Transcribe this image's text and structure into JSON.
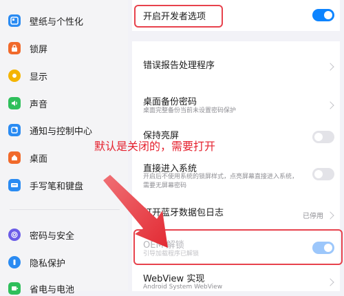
{
  "sidebar": {
    "items": [
      {
        "label": "壁纸与个性化",
        "icon": "palette-icon",
        "color": "#2a8bf2"
      },
      {
        "label": "锁屏",
        "icon": "lock-icon",
        "color": "#f16a2b"
      },
      {
        "label": "显示",
        "icon": "sun-icon",
        "color": "#f4b400"
      },
      {
        "label": "声音",
        "icon": "speaker-icon",
        "color": "#2fbf5b"
      },
      {
        "label": "通知与控制中心",
        "icon": "notification-icon",
        "color": "#2a8bf2"
      },
      {
        "label": "桌面",
        "icon": "home-icon",
        "color": "#f16a2b"
      },
      {
        "label": "手写笔和键盘",
        "icon": "keyboard-icon",
        "color": "#2a8bf2"
      },
      {
        "label": "密码与安全",
        "icon": "fingerprint-icon",
        "color": "#6b5ce7"
      },
      {
        "label": "隐私保护",
        "icon": "privacy-icon",
        "color": "#2a8bf2"
      },
      {
        "label": "省电与电池",
        "icon": "battery-icon",
        "color": "#2fbf5b"
      }
    ]
  },
  "main": {
    "developer_options": {
      "title": "开启开发者选项",
      "enabled": true
    },
    "bug_report": {
      "title": "错误报告处理程序"
    },
    "desktop_backup": {
      "title": "桌面备份密码",
      "subtitle": "桌面完整备份当前未设置密码保护"
    },
    "stay_awake": {
      "title": "保持亮屏",
      "enabled": false
    },
    "direct_boot": {
      "title": "直接进入系统",
      "subtitle_line1": "开启后不使用系统的锁屏样式，点亮屏幕直接进入系统，",
      "subtitle_line2": "需要无屏幕密码",
      "enabled": false
    },
    "bluetooth_log": {
      "title": "打开蓝牙数据包日志",
      "status": "已停用"
    },
    "oem_unlock": {
      "title": "OEM 解锁",
      "subtitle": "引导加载程序已解锁",
      "enabled": true
    },
    "webview": {
      "title": "WebView 实现",
      "subtitle": "Android System WebView"
    }
  },
  "annotation": {
    "text": "默认是关闭的，需要打开",
    "color": "#e5212e"
  },
  "colors": {
    "accent": "#0d84ff",
    "highlight": "#e7414c"
  }
}
